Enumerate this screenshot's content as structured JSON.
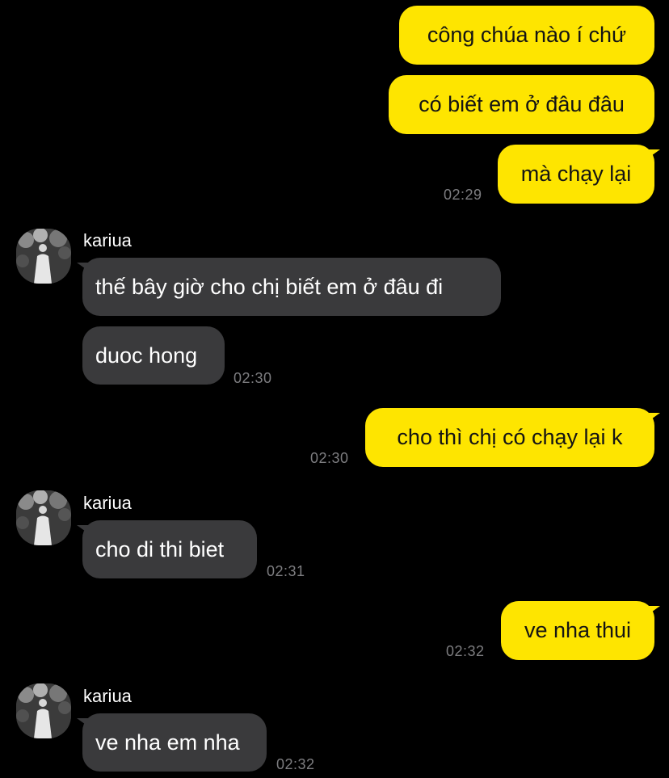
{
  "messages": {
    "m1": "công chúa nào í chứ",
    "m2": "có biết em ở đâu đâu",
    "m3": "mà chạy lại",
    "t1": "02:29",
    "g1_sender": "kariua",
    "m4": "thế bây giờ cho chị biết em ở đâu đi",
    "m5": "duoc hong",
    "t2": "02:30",
    "m6": "cho thì chị có chạy lại k",
    "t3": "02:30",
    "g2_sender": "kariua",
    "m7": "cho di thi biet",
    "t4": "02:31",
    "m8": "ve nha thui",
    "t5": "02:32",
    "g3_sender": "kariua",
    "m9": "ve nha em nha",
    "t6": "02:32"
  },
  "colors": {
    "background": "#000000",
    "my_bubble": "#fee500",
    "their_bubble": "#3a3a3c",
    "timestamp": "#7d7d80"
  },
  "icons": {
    "avatar": "profile-photo"
  }
}
